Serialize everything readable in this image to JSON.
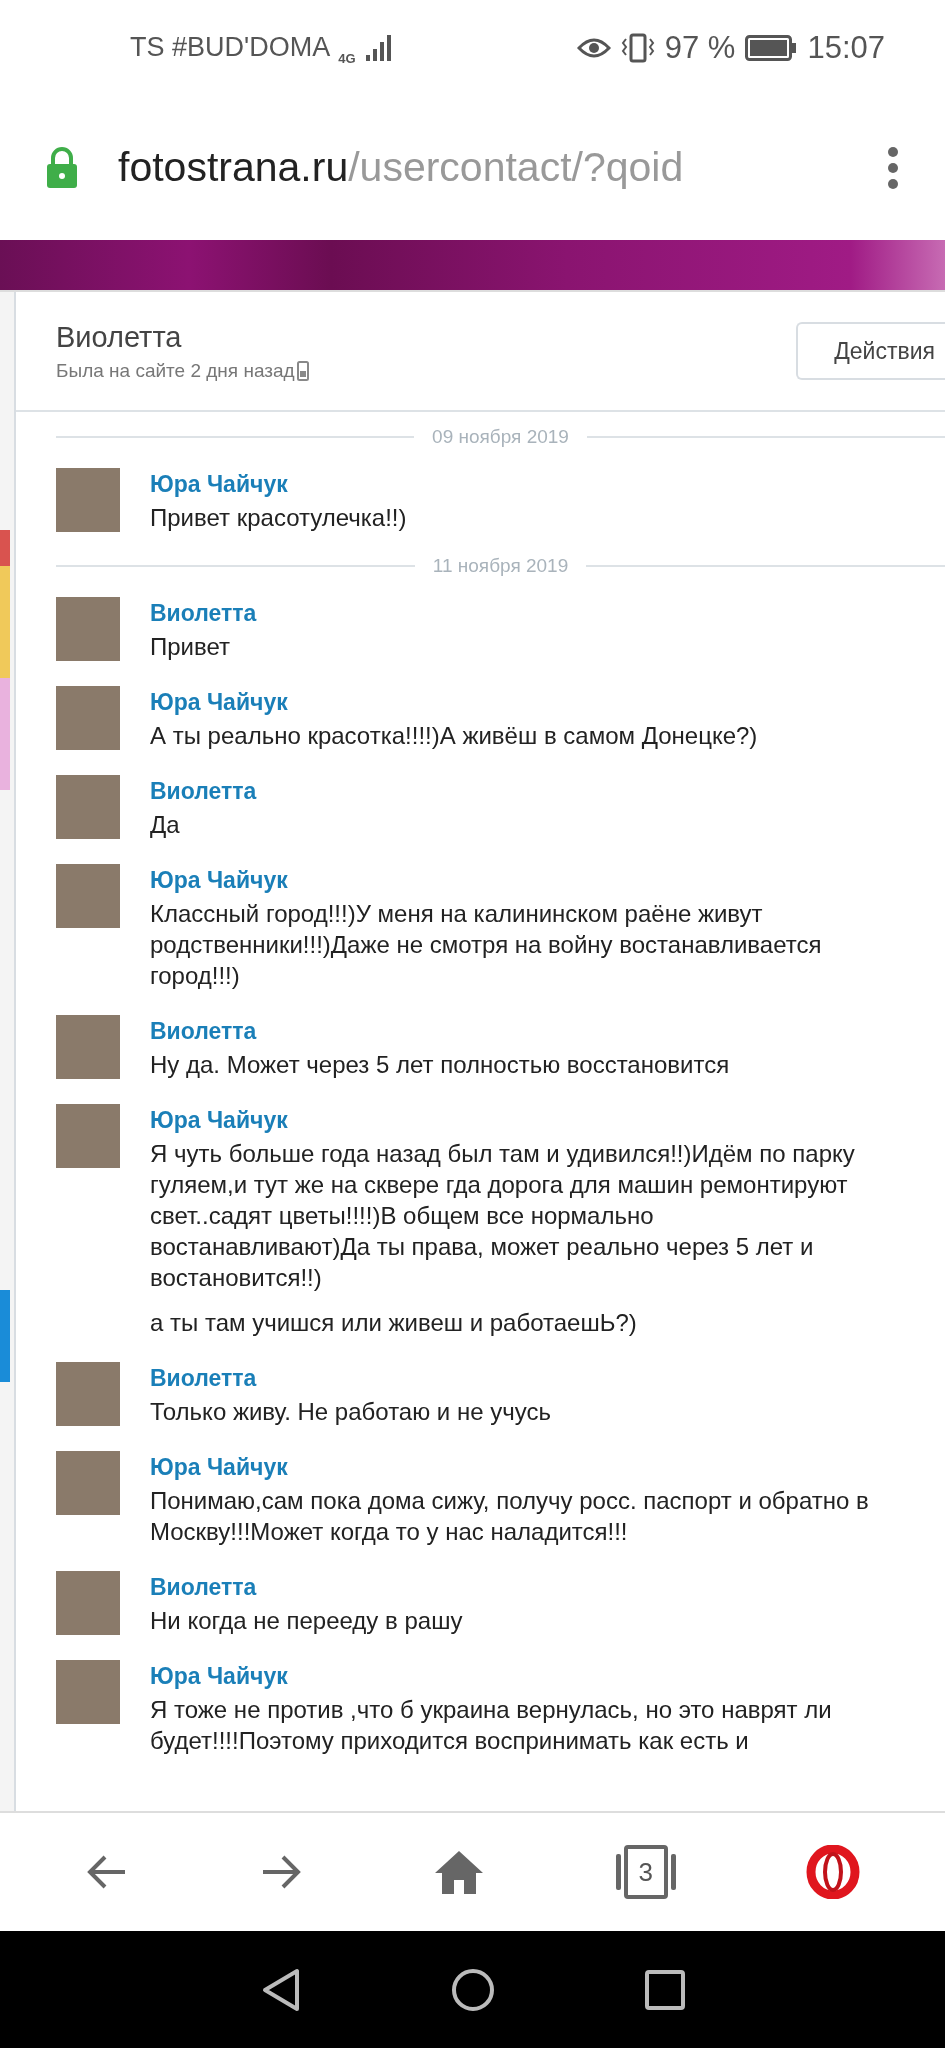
{
  "status_bar": {
    "carrier": "TS #BUD'DOMA",
    "network": "4G",
    "battery": "97 %",
    "time": "15:07"
  },
  "address_bar": {
    "host": "fotostrana.ru",
    "path": "/usercontact/?qoid"
  },
  "contact": {
    "name": "Виолетта",
    "last_seen": "Была на сайте 2 дня назад",
    "actions_button": "Действия"
  },
  "items": [
    {
      "kind": "date",
      "text": "09 ноября 2019"
    },
    {
      "kind": "message",
      "sender": "Юра Чайчук",
      "texts": [
        "Привет красотулечка!!)"
      ]
    },
    {
      "kind": "date",
      "text": "11 ноября 2019"
    },
    {
      "kind": "message",
      "sender": "Виолетта",
      "texts": [
        "Привет"
      ]
    },
    {
      "kind": "message",
      "sender": "Юра Чайчук",
      "texts": [
        "А ты реально красотка!!!!)А живёш в самом Донецке?)"
      ]
    },
    {
      "kind": "message",
      "sender": "Виолетта",
      "texts": [
        "Да"
      ]
    },
    {
      "kind": "message",
      "sender": "Юра Чайчук",
      "texts": [
        "Классный город!!!)У меня на калининском раёне живут родственники!!!)Даже не смотря на войну востанавливается город!!!)"
      ]
    },
    {
      "kind": "message",
      "sender": "Виолетта",
      "texts": [
        "Ну да. Может через 5 лет полностью восстановится"
      ]
    },
    {
      "kind": "message",
      "sender": "Юра Чайчук",
      "texts": [
        "Я чуть больше года назад был там и удивился!!)Идём по парку гуляем,и тут же на сквере гда дорога для машин ремонтируют свет..садят цветы!!!!)В общем все нормально востанавливают)Да ты права, может реально через 5 лет и востановится!!)",
        "а ты там учишся или живеш и работаешЬ?)"
      ]
    },
    {
      "kind": "message",
      "sender": "Виолетта",
      "texts": [
        "Только живу. Не работаю и не учусь"
      ]
    },
    {
      "kind": "message",
      "sender": "Юра Чайчук",
      "texts": [
        "Понимаю,сам пока дома сижу, получу росс. паспорт и обратно в Москву!!!Может когда то у нас наладится!!!"
      ]
    },
    {
      "kind": "message",
      "sender": "Виолетта",
      "texts": [
        "Ни когда не перееду в рашу"
      ]
    },
    {
      "kind": "message",
      "sender": "Юра Чайчук",
      "texts": [
        "Я тоже не против ,что б украина вернулась, но это наврят ли будет!!!!Поэтому приходится воспринимать как есть и"
      ]
    }
  ],
  "toolbar": {
    "tabs_count": "3"
  }
}
